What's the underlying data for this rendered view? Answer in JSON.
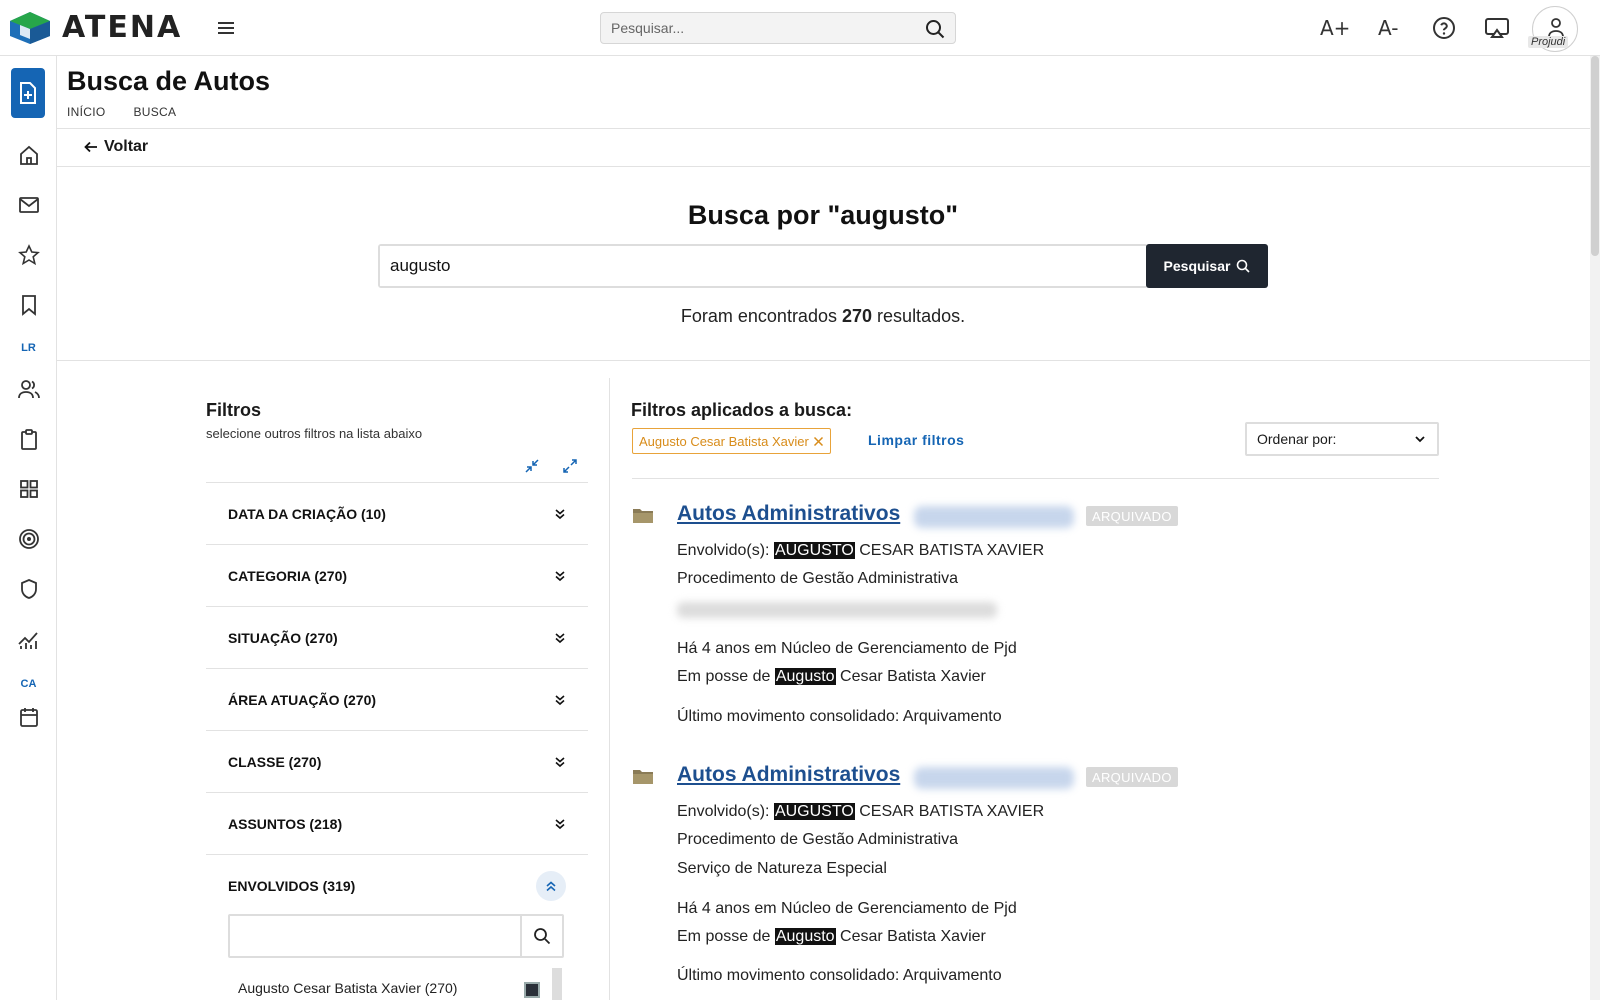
{
  "app": {
    "name": "ATENA"
  },
  "topbar": {
    "search_placeholder": "Pesquisar...",
    "font_increase": "A+",
    "font_decrease": "A-",
    "user_label": "Projudi"
  },
  "sidebar": {
    "tag_lr": "LR",
    "tag_ca": "CA"
  },
  "page": {
    "title": "Busca de Autos",
    "breadcrumb": [
      "INÍCIO",
      "BUSCA"
    ],
    "back_label": "Voltar"
  },
  "search": {
    "heading": "Busca por \"augusto\"",
    "value": "augusto",
    "button_label": "Pesquisar",
    "results_prefix": "Foram encontrados",
    "results_count": "270",
    "results_suffix": "resultados."
  },
  "filters": {
    "title": "Filtros",
    "subtitle": "selecione outros filtros na lista abaixo",
    "items": [
      {
        "label": "DATA DA CRIAÇÃO (10)"
      },
      {
        "label": "CATEGORIA (270)"
      },
      {
        "label": "SITUAÇÃO (270)"
      },
      {
        "label": "ÁREA ATUAÇÃO (270)"
      },
      {
        "label": "CLASSE (270)"
      },
      {
        "label": "ASSUNTOS (218)"
      },
      {
        "label": "ENVOLVIDOS (319)"
      }
    ],
    "envolvidos_search_value": "",
    "envolvidos_option": "Augusto Cesar Batista Xavier (270)"
  },
  "applied": {
    "title": "Filtros aplicados a busca:",
    "chip_label": "Augusto Cesar Batista Xavier",
    "clear_label": "Limpar filtros",
    "order_label": "Ordenar por:"
  },
  "results": [
    {
      "title": "Autos Administrativos",
      "badge": "ARQUIVADO",
      "envolvido_prefix": "Envolvido(s):",
      "envolvido_hl": "AUGUSTO",
      "envolvido_rest": "CESAR BATISTA XAVIER",
      "procedimento": "Procedimento de Gestão Administrativa",
      "servico": "",
      "tempo": "Há 4 anos em Núcleo de Gerenciamento de Pjd",
      "posse_prefix": "Em posse de",
      "posse_hl": "Augusto",
      "posse_rest": "Cesar Batista Xavier",
      "movimento": "Último movimento consolidado: Arquivamento"
    },
    {
      "title": "Autos Administrativos",
      "badge": "ARQUIVADO",
      "envolvido_prefix": "Envolvido(s):",
      "envolvido_hl": "AUGUSTO",
      "envolvido_rest": "CESAR BATISTA XAVIER",
      "procedimento": "Procedimento de Gestão Administrativa",
      "servico": "Serviço de Natureza Especial",
      "tempo": "Há 4 anos em Núcleo de Gerenciamento de Pjd",
      "posse_prefix": "Em posse de",
      "posse_hl": "Augusto",
      "posse_rest": "Cesar Batista Xavier",
      "movimento": "Último movimento consolidado: Arquivamento"
    }
  ],
  "colors": {
    "primary": "#1565b4",
    "dark_button": "#1f2630",
    "chip_border": "#e8a33a",
    "link": "#1d4f8f"
  }
}
